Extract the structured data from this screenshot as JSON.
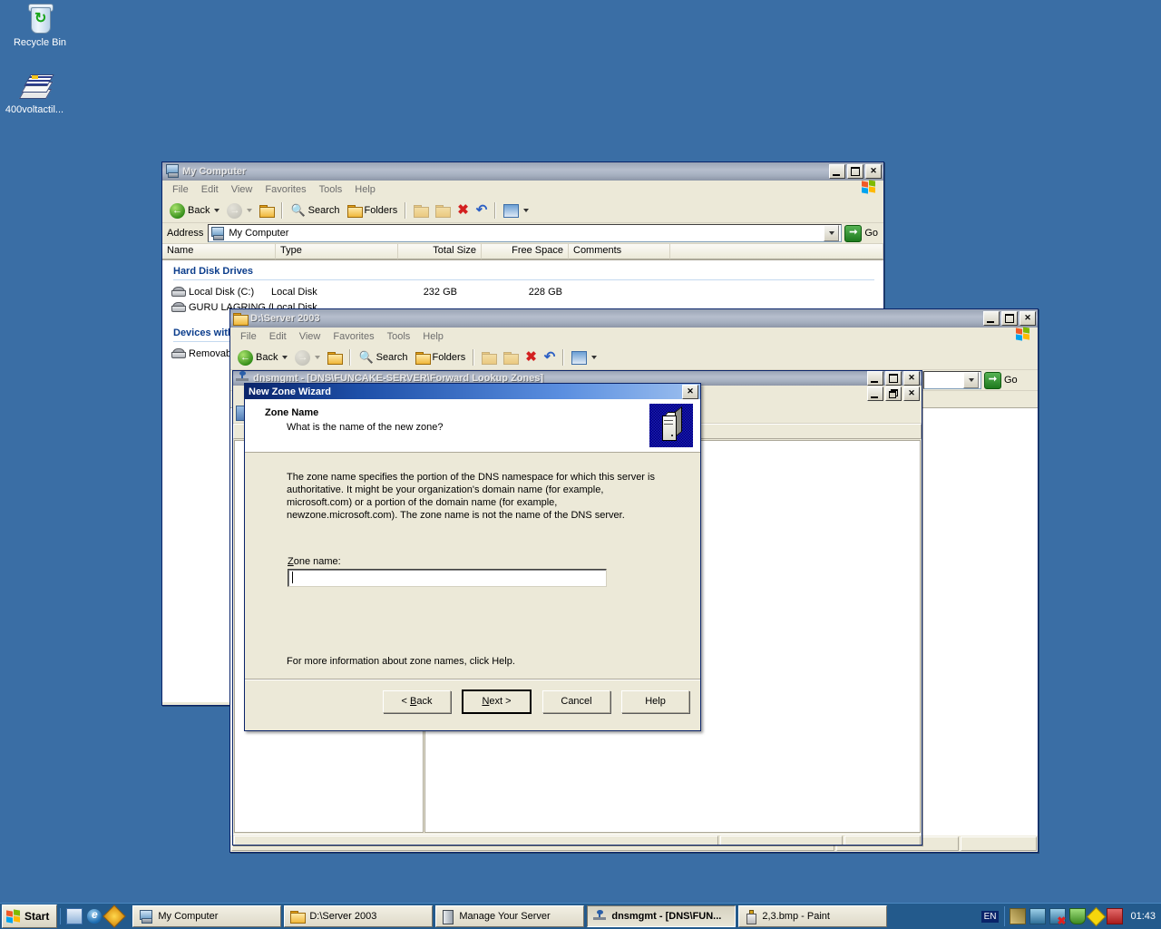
{
  "desktop": {
    "icons": [
      {
        "label": "Recycle Bin",
        "icon": "recycle-bin-icon"
      },
      {
        "label": "400voltactil...",
        "icon": "document-stack-icon"
      }
    ],
    "background_color": "#3a6ea5"
  },
  "my_computer_window": {
    "title": "My Computer",
    "icon": "my-computer-icon",
    "window_buttons": {
      "minimize": "_",
      "maximize": "□",
      "close": "✕"
    },
    "menu": [
      "File",
      "Edit",
      "View",
      "Favorites",
      "Tools",
      "Help"
    ],
    "toolbar": {
      "back": "Back",
      "forward": "",
      "up": "",
      "search": "Search",
      "folders": "Folders",
      "move_to": "",
      "copy_to": "",
      "delete": "",
      "undo": "",
      "views": ""
    },
    "address": {
      "label": "Address",
      "value": "My Computer",
      "go": "Go"
    },
    "columns": [
      "Name",
      "Type",
      "Total Size",
      "Free Space",
      "Comments"
    ],
    "groups": [
      {
        "title": "Hard Disk Drives",
        "rows": [
          {
            "name": "Local Disk (C:)",
            "type": "Local Disk",
            "total_size": "232 GB",
            "free_space": "228 GB",
            "comments": ""
          },
          {
            "name": "GURU LAGRING (X:)",
            "type": "Local Disk",
            "total_size": "",
            "free_space": "",
            "comments": ""
          }
        ]
      },
      {
        "title": "Devices with Removable Storage",
        "rows": [
          {
            "name": "Removable Disk",
            "type": "",
            "total_size": "",
            "free_space": "",
            "comments": ""
          }
        ]
      }
    ]
  },
  "server_window": {
    "title": "D:\\Server 2003",
    "icon": "folder-icon",
    "window_buttons": {
      "minimize": "_",
      "maximize": "□",
      "close": "✕"
    },
    "menu": [
      "File",
      "Edit",
      "View",
      "Favorites",
      "Tools",
      "Help"
    ],
    "toolbar": {
      "back": "Back",
      "search": "Search",
      "folders": "Folders"
    },
    "address": {
      "value": "",
      "go": "Go"
    }
  },
  "dnsmgmt_window": {
    "title": "dnsmgmt - [DNS\\FUNCAKE-SERVER\\Forward Lookup Zones]",
    "icon": "dns-console-icon",
    "window_buttons": {
      "minimize": "_",
      "maximize": "□",
      "close": "✕"
    },
    "child_buttons": {
      "minimize": "_",
      "restore": "❐",
      "close": "✕"
    },
    "columns": [
      "",
      ""
    ],
    "partial_text": "ng"
  },
  "wizard": {
    "title": "New Zone Wizard",
    "close_button": "✕",
    "banner_icon": "server-tower-icon",
    "heading": "Zone Name",
    "subheading": "What is the name of the new zone?",
    "body_text": "The zone name specifies the portion of the DNS namespace for which this server is authoritative. It might be your organization's domain name (for example,  microsoft.com) or a portion of the domain name (for example, newzone.microsoft.com). The zone name is not the name of the DNS server.",
    "field_label": "Zone name:",
    "field_value": "",
    "help_text": "For more information about zone names, click Help.",
    "buttons": {
      "back": "< Back",
      "back_accel": "B",
      "next": "Next >",
      "next_accel": "N",
      "cancel": "Cancel",
      "help": "Help"
    }
  },
  "taskbar": {
    "start_label": "Start",
    "quick_launch": [
      {
        "name": "show-desktop-icon"
      },
      {
        "name": "internet-explorer-icon"
      },
      {
        "name": "media-player-icon"
      }
    ],
    "tasks": [
      {
        "label": "My Computer",
        "icon": "my-computer-icon",
        "active": false
      },
      {
        "label": "D:\\Server 2003",
        "icon": "folder-icon",
        "active": false
      },
      {
        "label": "Manage Your Server",
        "icon": "server-icon",
        "active": false
      },
      {
        "label": "dnsmgmt - [DNS\\FUN...",
        "icon": "dns-console-icon",
        "active": true
      },
      {
        "label": "2,3.bmp - Paint",
        "icon": "paint-icon",
        "active": false
      }
    ],
    "language": "EN",
    "tray_icons": [
      "network-tools-icon",
      "network-icon",
      "network-disconnected-icon",
      "shield-icon",
      "yellow-diamond-icon",
      "update-icon"
    ],
    "clock": "01:43"
  },
  "colors": {
    "desktop": "#3a6ea5",
    "title_active": "#0a246a",
    "title_inactive": "#9aa4b5",
    "window_face": "#ece9d8",
    "group_header": "#0b3d8c",
    "taskbar": "#235a8c"
  }
}
